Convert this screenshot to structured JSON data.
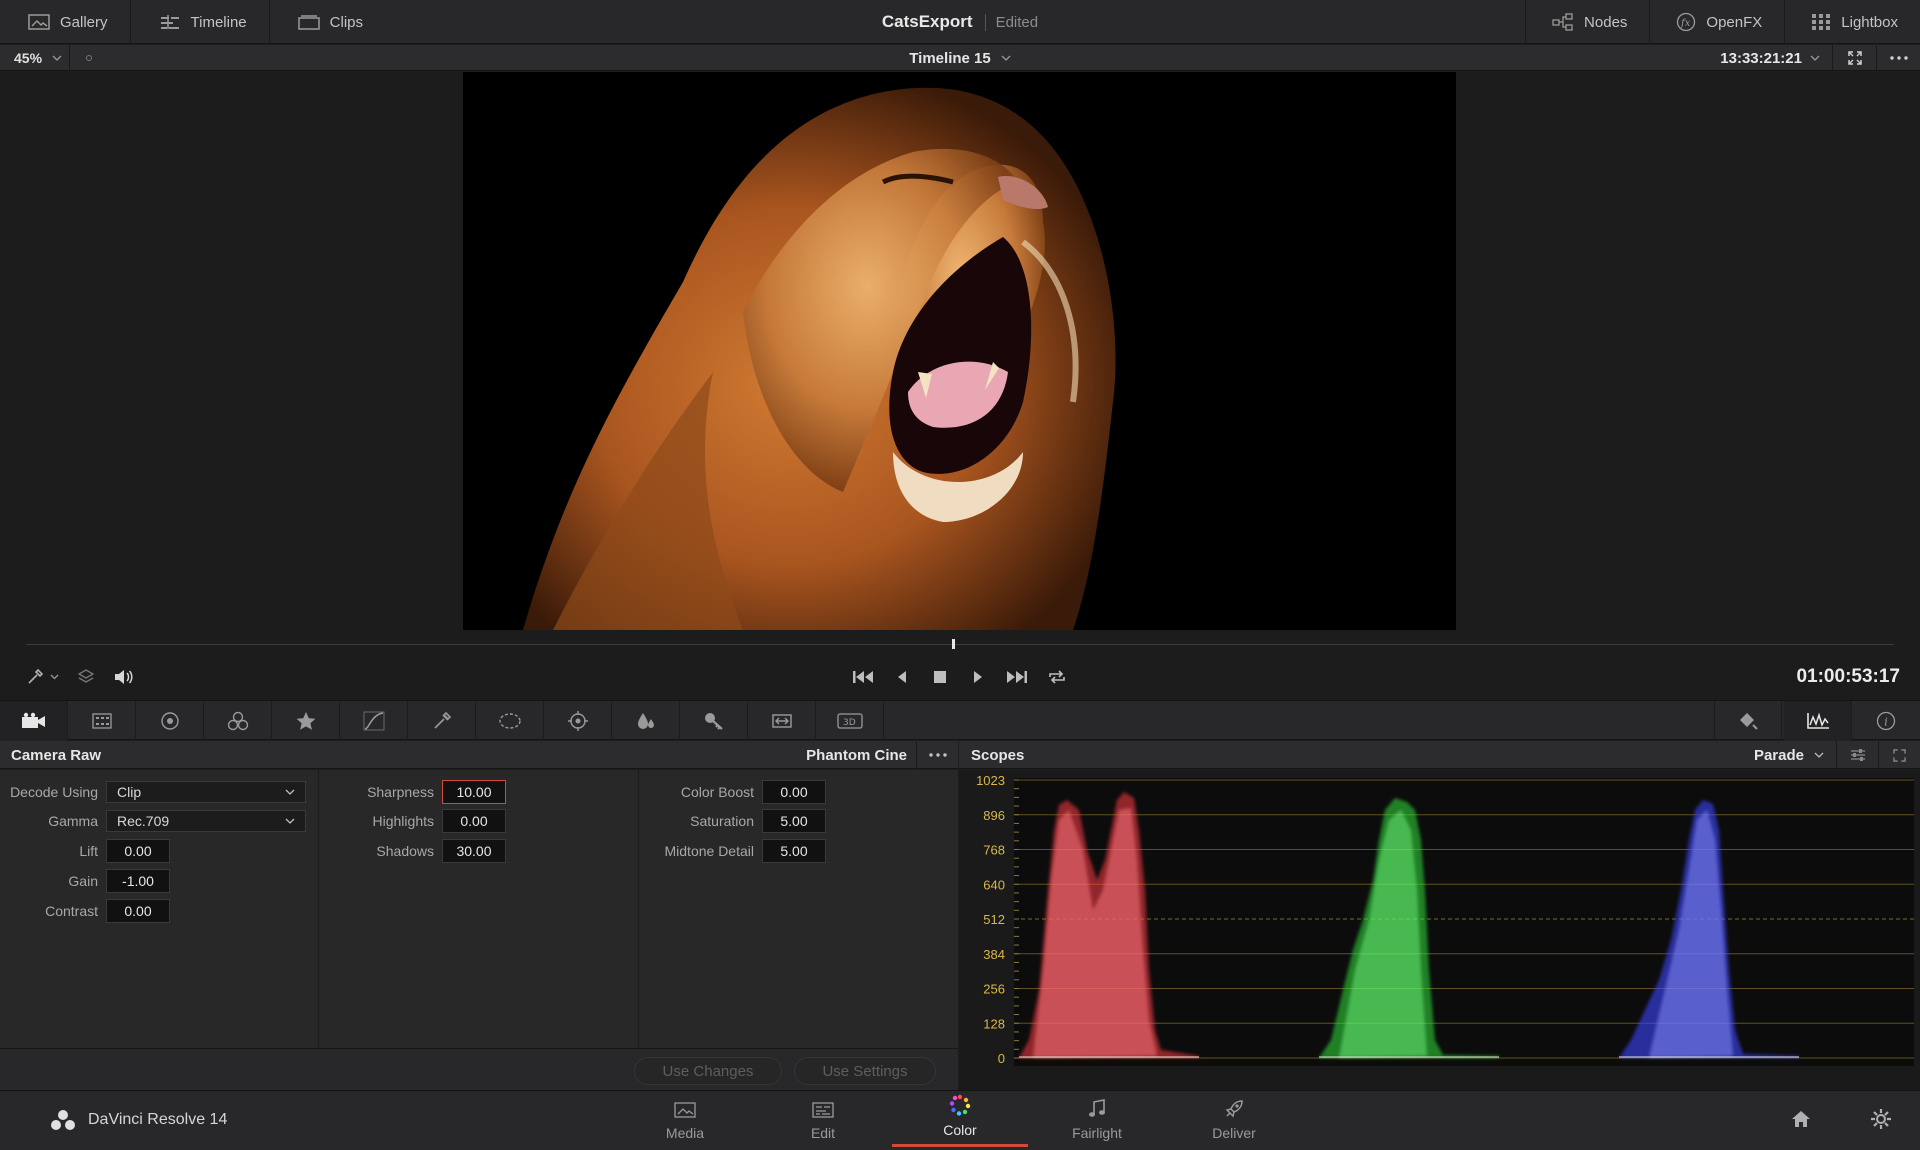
{
  "topbar": {
    "left_tabs": [
      {
        "label": "Gallery",
        "icon": "gallery-icon"
      },
      {
        "label": "Timeline",
        "icon": "timeline-icon"
      },
      {
        "label": "Clips",
        "icon": "clips-icon"
      }
    ],
    "project_name": "CatsExport",
    "project_status": "Edited",
    "right_tabs": [
      {
        "label": "Nodes",
        "icon": "nodes-icon"
      },
      {
        "label": "OpenFX",
        "icon": "fx-icon"
      },
      {
        "label": "Lightbox",
        "icon": "grid-icon"
      }
    ]
  },
  "viewer_bar": {
    "zoom": "45%",
    "timeline_name": "Timeline 15",
    "source_timecode": "13:33:21:21"
  },
  "transport": {
    "timecode": "01:00:53:17",
    "playhead_fraction": 0.496
  },
  "toolstrip": {
    "tools": [
      "camera-raw-icon",
      "color-match-icon",
      "color-wheels-icon",
      "rgb-mixer-icon",
      "motion-effects-icon",
      "curves-icon",
      "qualifier-icon",
      "window-icon",
      "tracker-icon",
      "blur-icon",
      "key-icon",
      "sizing-icon",
      "3d-icon"
    ],
    "right_tools": [
      "keyframe-icon",
      "scopes-icon",
      "info-icon"
    ]
  },
  "camera_raw": {
    "title": "Camera Raw",
    "format": "Phantom Cine",
    "col1": [
      {
        "label": "Decode Using",
        "value": "Clip",
        "type": "select"
      },
      {
        "label": "Gamma",
        "value": "Rec.709",
        "type": "select"
      },
      {
        "label": "Lift",
        "value": "0.00"
      },
      {
        "label": "Gain",
        "value": "-1.00"
      },
      {
        "label": "Contrast",
        "value": "0.00"
      }
    ],
    "col2": [
      {
        "label": "Sharpness",
        "value": "10.00",
        "selected": true
      },
      {
        "label": "Highlights",
        "value": "0.00"
      },
      {
        "label": "Shadows",
        "value": "30.00"
      }
    ],
    "col3": [
      {
        "label": "Color Boost",
        "value": "0.00"
      },
      {
        "label": "Saturation",
        "value": "5.00"
      },
      {
        "label": "Midtone Detail",
        "value": "5.00"
      }
    ],
    "use_changes": "Use Changes",
    "use_settings": "Use Settings"
  },
  "scopes": {
    "title": "Scopes",
    "mode": "Parade",
    "y_ticks": [
      "1023",
      "896",
      "768",
      "640",
      "512",
      "384",
      "256",
      "128",
      "0"
    ],
    "channel_colors": [
      "#ff4f55",
      "#3fe04a",
      "#4a55ff"
    ]
  },
  "bottombar": {
    "app_name": "DaVinci Resolve 14",
    "pages": [
      {
        "label": "Media",
        "icon": "media-icon"
      },
      {
        "label": "Edit",
        "icon": "edit-icon"
      },
      {
        "label": "Color",
        "icon": "color-icon",
        "active": true
      },
      {
        "label": "Fairlight",
        "icon": "music-note-icon"
      },
      {
        "label": "Deliver",
        "icon": "rocket-icon"
      }
    ]
  }
}
